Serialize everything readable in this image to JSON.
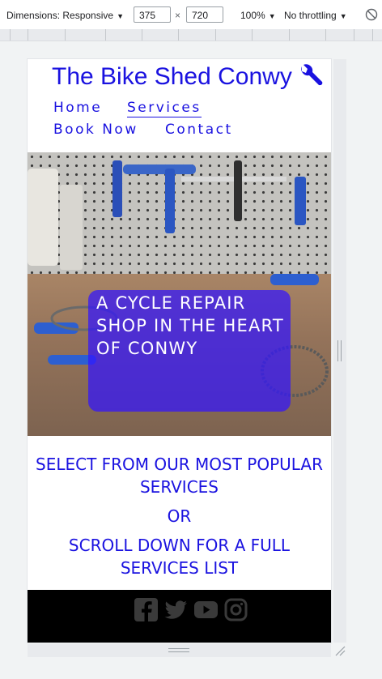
{
  "devtools": {
    "dimensions_label": "Dimensions: Responsive",
    "width": "375",
    "height": "720",
    "times": "×",
    "zoom": "100%",
    "throttling": "No throttling",
    "caret": "▼"
  },
  "site": {
    "brand": "The Bike Shed Conwy",
    "nav": [
      {
        "label": "Home"
      },
      {
        "label": "Services"
      },
      {
        "label": "Book Now"
      },
      {
        "label": "Contact"
      }
    ],
    "hero_text": "A CYCLE REPAIR SHOP IN THE HEART OF CONWY",
    "intro": {
      "line1": "SELECT FROM OUR MOST POPULAR SERVICES",
      "or": "OR",
      "line2": "SCROLL DOWN FOR A FULL SERVICES LIST"
    },
    "social_icons": [
      "facebook-icon",
      "twitter-icon",
      "youtube-icon",
      "instagram-icon"
    ]
  },
  "colors": {
    "brand_blue": "#1a12e0",
    "hero_overlay": "#3214ff",
    "footer_bg": "#000000",
    "social_icon": "#3a3a3a"
  }
}
